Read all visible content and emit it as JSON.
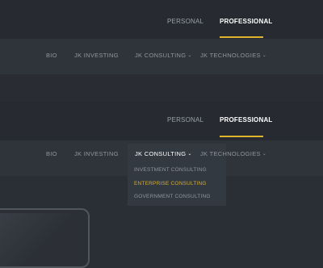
{
  "panels": [
    {
      "tabs": [
        {
          "label": "PERSONAL",
          "active": false
        },
        {
          "label": "PROFESSIONAL",
          "active": true
        }
      ],
      "subnav": [
        {
          "label": "BIO",
          "has_dropdown": false
        },
        {
          "label": "JK INVESTING",
          "has_dropdown": false
        },
        {
          "label": "JK CONSULTING",
          "has_dropdown": true
        },
        {
          "label": "JK TECHNOLOGIES",
          "has_dropdown": true
        }
      ]
    },
    {
      "tabs": [
        {
          "label": "PERSONAL",
          "active": false
        },
        {
          "label": "PROFESSIONAL",
          "active": true
        }
      ],
      "subnav": [
        {
          "label": "BIO",
          "has_dropdown": false
        },
        {
          "label": "JK INVESTING",
          "has_dropdown": false
        },
        {
          "label": "JK CONSULTING",
          "has_dropdown": true,
          "open": true
        },
        {
          "label": "JK TECHNOLOGIES",
          "has_dropdown": true
        }
      ],
      "dropdown": [
        {
          "label": "INVESTMENT CONSULTING",
          "highlighted": false
        },
        {
          "label": "ENTERPRISE CONSULTING",
          "highlighted": true
        },
        {
          "label": "GOVERNMENT CONSULTING",
          "highlighted": false
        }
      ]
    }
  ],
  "colors": {
    "accent": "#e0b42a",
    "highlight_text": "#d2ad35",
    "background": "#2a2e35"
  },
  "icons": {
    "chevron": "chevron-down-icon"
  }
}
